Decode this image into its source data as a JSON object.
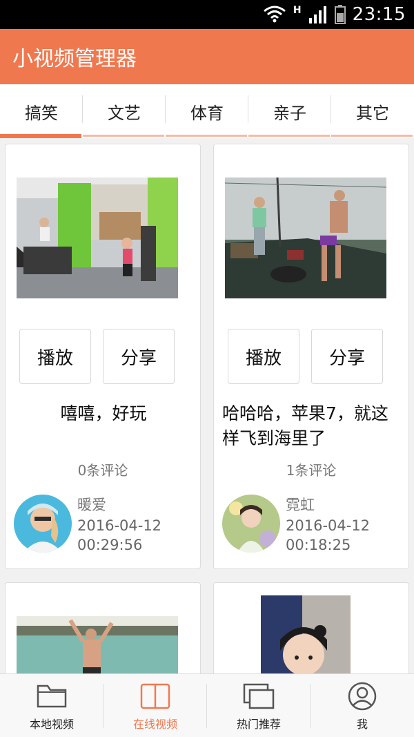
{
  "status_bar": {
    "time": "23:15",
    "network_label": "H",
    "icons": [
      "wifi-icon",
      "signal-icon",
      "battery-icon"
    ]
  },
  "app_bar": {
    "title": "小视频管理器",
    "color": "#f0784f"
  },
  "tabs": [
    {
      "label": "搞笑",
      "active": true
    },
    {
      "label": "文艺",
      "active": false
    },
    {
      "label": "体育",
      "active": false
    },
    {
      "label": "亲子",
      "active": false
    },
    {
      "label": "其它",
      "active": false
    }
  ],
  "videos": [
    {
      "play_label": "播放",
      "share_label": "分享",
      "caption": "嘻嘻，好玩",
      "comments": "0条评论",
      "user": "暖爱",
      "date": "2016-04-12",
      "time": "00:29:56"
    },
    {
      "play_label": "播放",
      "share_label": "分享",
      "caption": "哈哈哈，苹果7，就这样飞到海里了",
      "comments": "1条评论",
      "user": "霓虹",
      "date": "2016-04-12",
      "time": "00:18:25"
    }
  ],
  "bottom_nav": [
    {
      "label": "本地视频",
      "icon": "folder-icon",
      "active": false
    },
    {
      "label": "在线视频",
      "icon": "book-icon",
      "active": true
    },
    {
      "label": "热门推荐",
      "icon": "windows-icon",
      "active": false
    },
    {
      "label": "我",
      "icon": "profile-icon",
      "active": false
    }
  ],
  "colors": {
    "accent": "#f0784f",
    "accent_light": "#f7b9a3"
  }
}
